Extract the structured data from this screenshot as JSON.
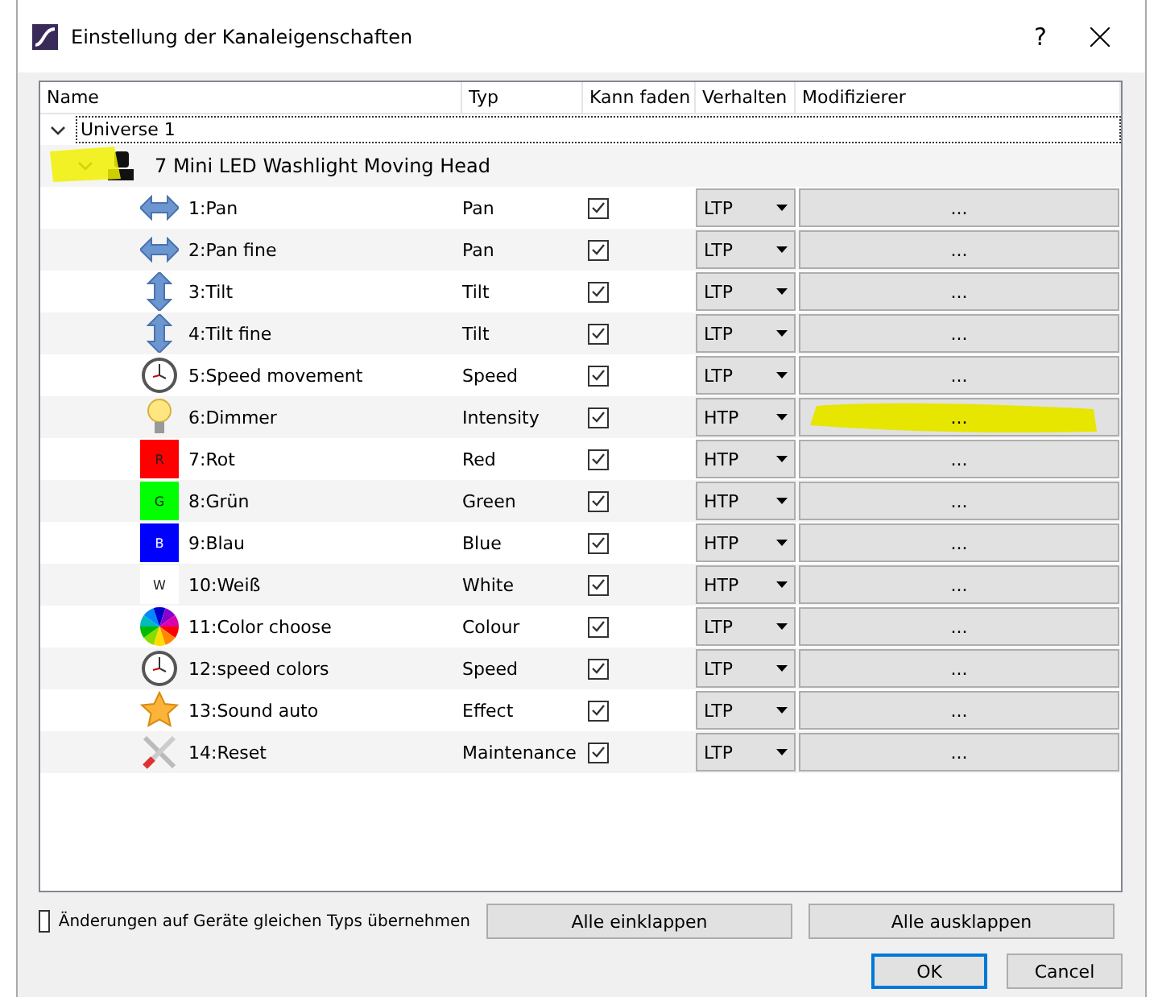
{
  "window": {
    "title": "Einstellung der Kanaleigenschaften",
    "help": "?"
  },
  "columns": [
    "Name",
    "Typ",
    "Kann faden",
    "Verhalten",
    "Modifizierer"
  ],
  "universe": {
    "label": "Universe 1",
    "expanded": true
  },
  "fixture": {
    "label": "7 Mini LED Washlight Moving Head",
    "expanded": true,
    "highlighted": true
  },
  "channels": [
    {
      "kind": "pan",
      "name": "1:Pan",
      "type": "Pan",
      "can_fade": true,
      "behaviour": "LTP",
      "modifier": "...",
      "highlighted": false
    },
    {
      "kind": "pan",
      "name": "2:Pan fine",
      "type": "Pan",
      "can_fade": true,
      "behaviour": "LTP",
      "modifier": "...",
      "highlighted": false
    },
    {
      "kind": "tilt",
      "name": "3:Tilt",
      "type": "Tilt",
      "can_fade": true,
      "behaviour": "LTP",
      "modifier": "...",
      "highlighted": false
    },
    {
      "kind": "tilt",
      "name": "4:Tilt fine",
      "type": "Tilt",
      "can_fade": true,
      "behaviour": "LTP",
      "modifier": "...",
      "highlighted": false
    },
    {
      "kind": "clock",
      "name": "5:Speed movement",
      "type": "Speed",
      "can_fade": true,
      "behaviour": "LTP",
      "modifier": "...",
      "highlighted": false
    },
    {
      "kind": "bulb",
      "name": "6:Dimmer",
      "type": "Intensity",
      "can_fade": true,
      "behaviour": "HTP",
      "modifier": "...",
      "highlighted": true
    },
    {
      "kind": "swatch",
      "letter": "R",
      "color": "#ff0000",
      "name": "7:Rot",
      "type": "Red",
      "can_fade": true,
      "behaviour": "HTP",
      "modifier": "...",
      "highlighted": false
    },
    {
      "kind": "swatch",
      "letter": "G",
      "color": "#00ff00",
      "name": "8:Grün",
      "type": "Green",
      "can_fade": true,
      "behaviour": "HTP",
      "modifier": "...",
      "highlighted": false
    },
    {
      "kind": "swatch",
      "letter": "B",
      "color": "#0000ff",
      "name": "9:Blau",
      "type": "Blue",
      "can_fade": true,
      "behaviour": "HTP",
      "modifier": "...",
      "highlighted": false
    },
    {
      "kind": "swatch",
      "letter": "W",
      "color": "#ffffff",
      "name": "10:Weiß",
      "type": "White",
      "can_fade": true,
      "behaviour": "HTP",
      "modifier": "...",
      "highlighted": false
    },
    {
      "kind": "wheel",
      "name": "11:Color choose",
      "type": "Colour",
      "can_fade": true,
      "behaviour": "LTP",
      "modifier": "...",
      "highlighted": false
    },
    {
      "kind": "clock",
      "name": "12:speed colors",
      "type": "Speed",
      "can_fade": true,
      "behaviour": "LTP",
      "modifier": "...",
      "highlighted": false
    },
    {
      "kind": "star",
      "name": "13:Sound auto",
      "type": "Effect",
      "can_fade": true,
      "behaviour": "LTP",
      "modifier": "...",
      "highlighted": false
    },
    {
      "kind": "tools",
      "name": "14:Reset",
      "type": "Maintenance",
      "can_fade": true,
      "behaviour": "LTP",
      "modifier": "...",
      "highlighted": false
    }
  ],
  "apply_same_type": {
    "label": "Änderungen auf Geräte gleichen Typs übernehmen",
    "checked": false
  },
  "buttons": [
    {
      "label": "Alle einklappen",
      "kind": "wide"
    },
    {
      "label": "Alle ausklappen",
      "kind": "wide"
    },
    {
      "label": "OK",
      "kind": "default"
    },
    {
      "label": "Cancel",
      "kind": "plain"
    }
  ]
}
